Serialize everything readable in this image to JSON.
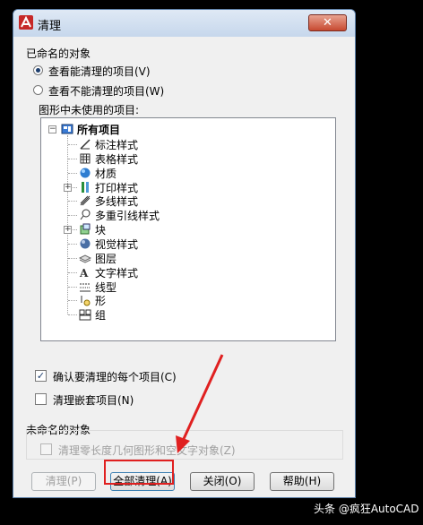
{
  "window": {
    "title": "清理",
    "close_glyph": "✕"
  },
  "named_objects": {
    "group_label": "已命名的对象",
    "radio_purgeable": "查看能清理的项目(V)",
    "radio_not_purgeable": "查看不能清理的项目(W)",
    "selected_radio": "radio_purgeable",
    "tree_label": "图形中未使用的项目:",
    "tree": {
      "root": "所有项目",
      "items": [
        {
          "label": "标注样式",
          "icon": "dimension-style-icon",
          "expandable": false
        },
        {
          "label": "表格样式",
          "icon": "table-style-icon",
          "expandable": false
        },
        {
          "label": "材质",
          "icon": "material-icon",
          "expandable": false
        },
        {
          "label": "打印样式",
          "icon": "plot-style-icon",
          "expandable": true
        },
        {
          "label": "多线样式",
          "icon": "multiline-style-icon",
          "expandable": false
        },
        {
          "label": "多重引线样式",
          "icon": "multileader-style-icon",
          "expandable": false
        },
        {
          "label": "块",
          "icon": "block-icon",
          "expandable": true
        },
        {
          "label": "视觉样式",
          "icon": "visual-style-icon",
          "expandable": false
        },
        {
          "label": "图层",
          "icon": "layer-icon",
          "expandable": false
        },
        {
          "label": "文字样式",
          "icon": "text-style-icon",
          "expandable": false
        },
        {
          "label": "线型",
          "icon": "linetype-icon",
          "expandable": false
        },
        {
          "label": "形",
          "icon": "shape-icon",
          "expandable": false
        },
        {
          "label": "组",
          "icon": "group-icon",
          "expandable": false
        }
      ]
    },
    "check_confirm": {
      "label": "确认要清理的每个项目(C)",
      "checked": true
    },
    "check_nested": {
      "label": "清理嵌套项目(N)",
      "checked": false
    }
  },
  "unnamed_objects": {
    "group_label": "未命名的对象",
    "check_zero_length": {
      "label": "清理零长度几何图形和空文字对象(Z)",
      "checked": false,
      "enabled": false
    }
  },
  "buttons": {
    "purge": "清理(P)",
    "purge_all": "全部清理(A)",
    "close": "关闭(O)",
    "help": "帮助(H)"
  },
  "watermark": "头条 @疯狂AutoCAD",
  "colors": {
    "highlight_red": "#e02020",
    "title_gradient": "#c6d7ec"
  }
}
